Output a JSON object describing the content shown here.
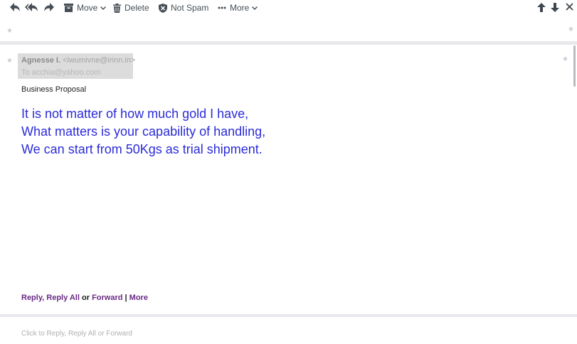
{
  "toolbar": {
    "move_label": "Move",
    "delete_label": "Delete",
    "not_spam_label": "Not Spam",
    "more_label": "More"
  },
  "message": {
    "sender_name": "Agnesse I.",
    "sender_email": "<iwumivne@irinn.in>",
    "to_line": "To acchia@yahoo.com",
    "subject": "Business Proposal",
    "body_lines": [
      "It is not matter of how much gold I have,",
      "What matters is your capability of handling,",
      "We can start from 50Kgs as trial shipment."
    ]
  },
  "actions": {
    "reply": "Reply",
    "sep1": ", ",
    "reply_all": "Reply All",
    "or": " or ",
    "forward": "Forward",
    "bar": " | ",
    "more": "More"
  },
  "quick_reply": "Click to Reply, Reply All or Forward",
  "icons": [
    "reply-icon",
    "reply-all-icon",
    "forward-icon",
    "move-icon",
    "delete-icon",
    "not-spam-icon",
    "more-dots-icon",
    "chevron-down-icon",
    "arrow-up-icon",
    "arrow-down-icon",
    "close-icon",
    "star-icon"
  ],
  "colors": {
    "body_text": "#2b2bd9",
    "action_links": "#6a2a86"
  }
}
